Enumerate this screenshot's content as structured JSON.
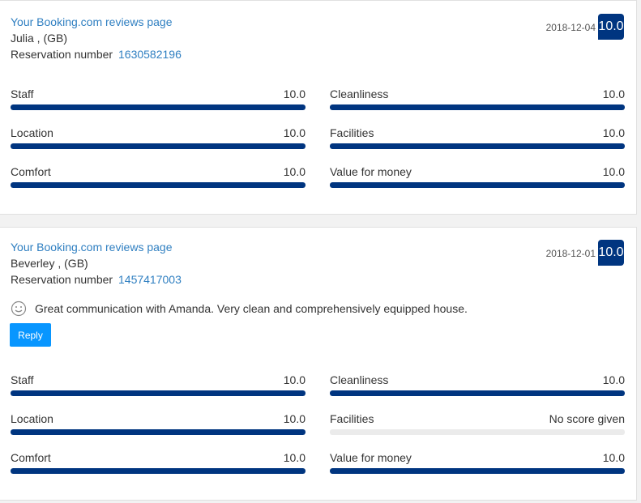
{
  "reviews": [
    {
      "source_link": "Your Booking.com reviews page",
      "guest": "Julia , (GB)",
      "reservation_label": "Reservation number",
      "reservation_number": "1630582196",
      "date": "2018-12-04",
      "score": "10.0",
      "comment": null,
      "metrics": [
        {
          "label": "Staff",
          "value": "10.0",
          "fill": 1.0
        },
        {
          "label": "Cleanliness",
          "value": "10.0",
          "fill": 1.0
        },
        {
          "label": "Location",
          "value": "10.0",
          "fill": 1.0
        },
        {
          "label": "Facilities",
          "value": "10.0",
          "fill": 1.0
        },
        {
          "label": "Comfort",
          "value": "10.0",
          "fill": 1.0
        },
        {
          "label": "Value for money",
          "value": "10.0",
          "fill": 1.0
        }
      ]
    },
    {
      "source_link": "Your Booking.com reviews page",
      "guest": "Beverley , (GB)",
      "reservation_label": "Reservation number",
      "reservation_number": "1457417003",
      "date": "2018-12-01",
      "score": "10.0",
      "comment": "Great communication with Amanda. Very clean and comprehensively equipped house.",
      "comment_icon": "smiley-icon",
      "reply_label": "Reply",
      "metrics": [
        {
          "label": "Staff",
          "value": "10.0",
          "fill": 1.0
        },
        {
          "label": "Cleanliness",
          "value": "10.0",
          "fill": 1.0
        },
        {
          "label": "Location",
          "value": "10.0",
          "fill": 1.0
        },
        {
          "label": "Facilities",
          "value": "No score given",
          "fill": 0.0
        },
        {
          "label": "Comfort",
          "value": "10.0",
          "fill": 1.0
        },
        {
          "label": "Value for money",
          "value": "10.0",
          "fill": 1.0
        }
      ]
    }
  ],
  "colors": {
    "link": "#2f7fc1",
    "score_bg": "#003580",
    "bar_fill": "#003580",
    "bar_track": "#ebebeb",
    "reply_button": "#0896ff"
  }
}
